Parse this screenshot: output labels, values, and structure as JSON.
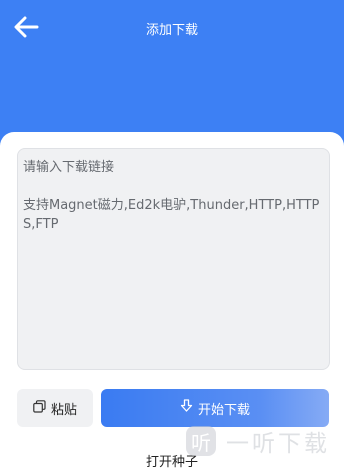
{
  "header": {
    "title": "添加下载",
    "back_icon": "arrow-left-icon",
    "color": "#3d80f4"
  },
  "input": {
    "placeholder_line1": "请输入下载链接",
    "placeholder_line2": "支持Magnet磁力,Ed2k电驴,Thunder,HTTP,HTTPS,FTP"
  },
  "actions": {
    "paste_label": "粘贴",
    "paste_icon": "clipboard-icon",
    "start_label": "开始下载",
    "start_icon": "download-icon",
    "open_seed_label": "打开种子"
  },
  "watermark": {
    "badge": "听",
    "text": "一听下载"
  }
}
